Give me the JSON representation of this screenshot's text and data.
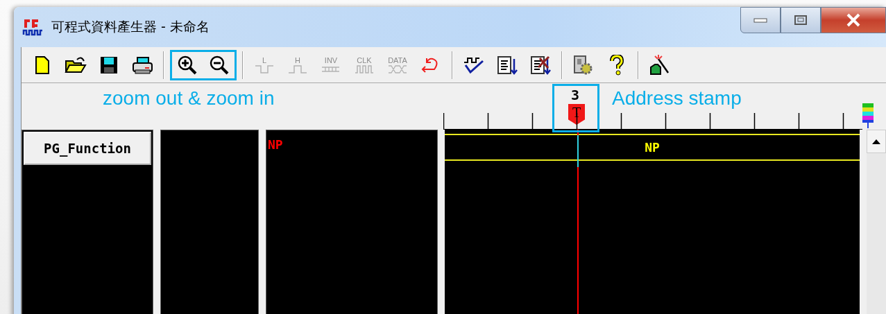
{
  "window": {
    "title": "可程式資料產生器 - 未命名"
  },
  "toolbar": {
    "groups": [
      {
        "highlighted": false,
        "items": [
          {
            "kind": "new",
            "disabled": false
          },
          {
            "kind": "open",
            "disabled": false
          },
          {
            "kind": "save",
            "disabled": false
          },
          {
            "kind": "print",
            "disabled": false
          }
        ]
      },
      {
        "highlighted": true,
        "items": [
          {
            "kind": "zoom-in",
            "disabled": false
          },
          {
            "kind": "zoom-out",
            "disabled": false
          }
        ]
      },
      {
        "highlighted": false,
        "items": [
          {
            "kind": "low",
            "label": "L",
            "disabled": true
          },
          {
            "kind": "high",
            "label": "H",
            "disabled": true
          },
          {
            "kind": "inv",
            "label": "INV",
            "disabled": true
          },
          {
            "kind": "clk",
            "label": "CLK",
            "disabled": true
          },
          {
            "kind": "data",
            "label": "DATA",
            "disabled": true
          },
          {
            "kind": "undo",
            "disabled": false
          }
        ]
      },
      {
        "highlighted": false,
        "items": [
          {
            "kind": "check",
            "disabled": false
          },
          {
            "kind": "sort",
            "disabled": false
          },
          {
            "kind": "clear-sort",
            "disabled": false
          }
        ]
      },
      {
        "highlighted": false,
        "items": [
          {
            "kind": "settings",
            "disabled": false
          },
          {
            "kind": "help",
            "disabled": false
          }
        ]
      },
      {
        "highlighted": false,
        "items": [
          {
            "kind": "tool",
            "disabled": false
          }
        ]
      }
    ]
  },
  "annotations": [
    {
      "text": "zoom out & zoom in"
    },
    {
      "text": "Address stamp"
    }
  ],
  "ruler": {
    "marker": {
      "number": "3",
      "label": "T"
    }
  },
  "panels": [
    {
      "kind": "header",
      "text": "PG_Function"
    },
    {
      "kind": "blank"
    },
    {
      "kind": "signal",
      "text": "NP"
    }
  ],
  "waveform": {
    "label": "NP"
  }
}
